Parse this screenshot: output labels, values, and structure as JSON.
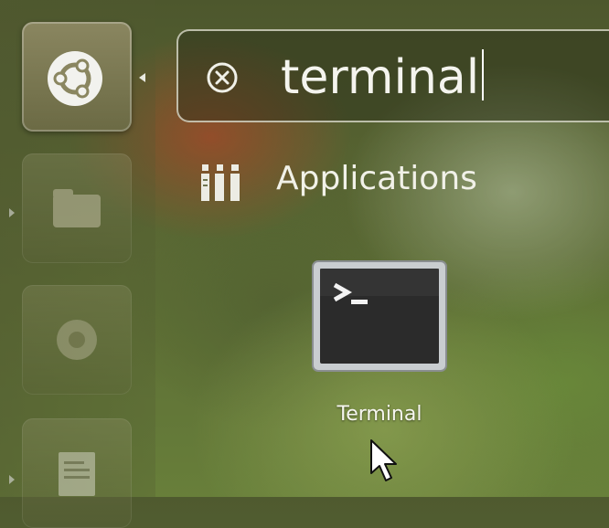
{
  "launcher": {
    "items": [
      {
        "name": "dash-home",
        "icon": "ubuntu-logo-icon",
        "active": true
      },
      {
        "name": "files",
        "icon": "folder-icon"
      },
      {
        "name": "chrome",
        "icon": "chrome-icon"
      },
      {
        "name": "document",
        "icon": "document-icon"
      }
    ]
  },
  "search": {
    "value": "terminal",
    "clear_icon": "clear-icon"
  },
  "category": {
    "label": "Applications",
    "icon": "applications-icon"
  },
  "results": [
    {
      "label": "Terminal",
      "icon": "terminal-icon"
    }
  ],
  "colors": {
    "text": "#f1f1ea",
    "terminal_bg": "#2b2b2b",
    "terminal_frame": "#bfc3c6"
  }
}
